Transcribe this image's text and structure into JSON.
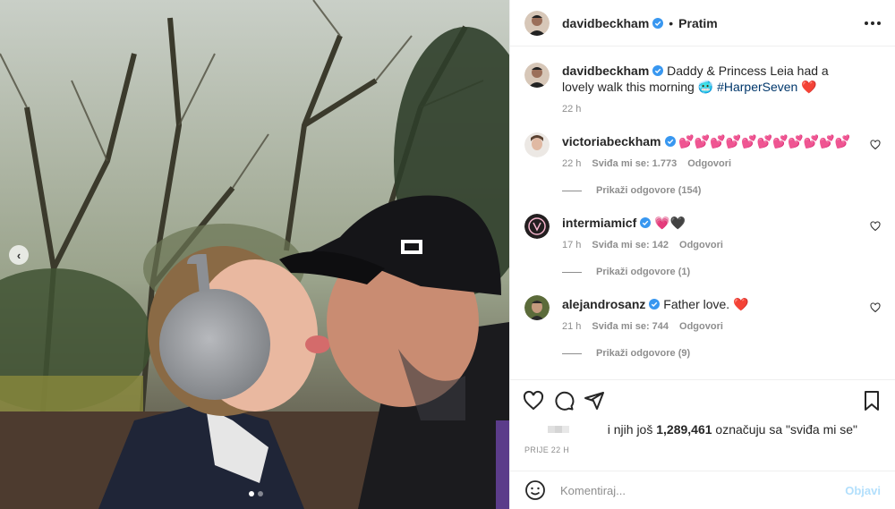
{
  "photo": {
    "alt": "",
    "carousel_prev": "‹",
    "slides": 2,
    "active_slide": 0
  },
  "header": {
    "username": "davidbeckham",
    "separator": "•",
    "follow_label": "Pratim"
  },
  "caption": {
    "username": "davidbeckham",
    "text": "Daddy & Princess Leia had a lovely walk this morning",
    "emoji": "🥶",
    "hashtag": "#HarperSeven",
    "heart": "❤️",
    "time": "22 h"
  },
  "comments": [
    {
      "username": "victoriabeckham",
      "text": "💕💕💕💕💕💕💕💕💕💕💕",
      "time": "22 h",
      "likes": "Sviđa mi se: 1.773",
      "reply": "Odgovori",
      "view_replies": "Prikaži odgovore (154)"
    },
    {
      "username": "intermiamicf",
      "text": "💗🖤",
      "time": "17 h",
      "likes": "Sviđa mi se: 142",
      "reply": "Odgovori",
      "view_replies": "Prikaži odgovore (1)"
    },
    {
      "username": "alejandrosanz",
      "text": "Father love. ❤️",
      "time": "21 h",
      "likes": "Sviđa mi se: 744",
      "reply": "Odgovori",
      "view_replies": "Prikaži odgovore (9)"
    }
  ],
  "likes": {
    "prefix": "i njih još ",
    "count": "1,289,461",
    "suffix": " označuju sa \"sviđa mi se\""
  },
  "post_date": "PRIJE 22 H",
  "comment_input": {
    "placeholder": "Komentiraj...",
    "post_label": "Objavi"
  },
  "colors": {
    "verified": "#3897f0",
    "link": "#00376b",
    "muted": "#8e8e8e",
    "post_disabled": "#b2dffc"
  },
  "icons": [
    "carousel-prev-icon",
    "verified-icon",
    "more-icon",
    "heart-icon",
    "comment-icon",
    "share-icon",
    "save-icon",
    "emoji-icon"
  ]
}
